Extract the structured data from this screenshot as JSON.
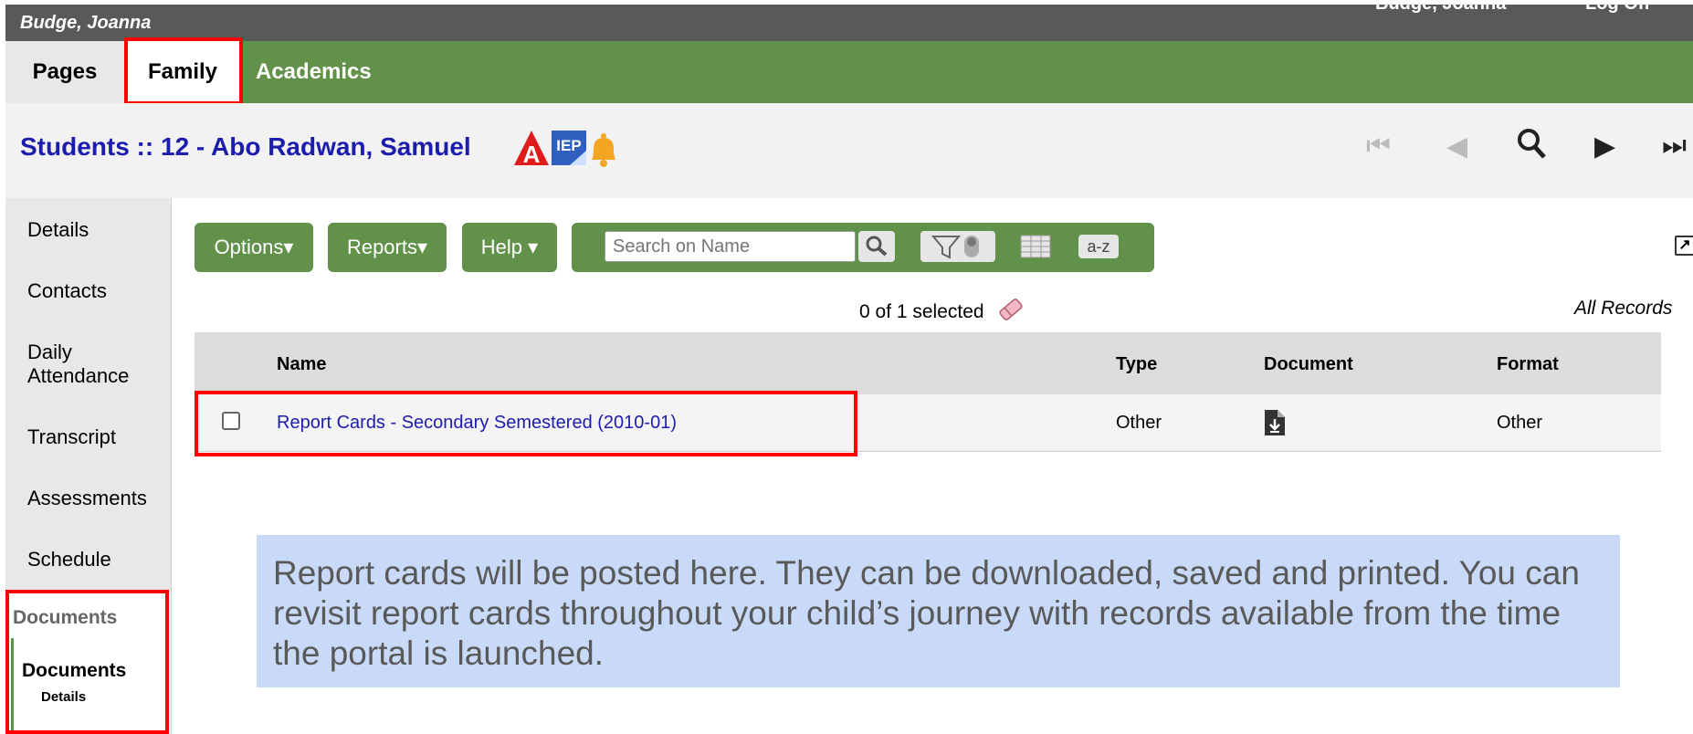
{
  "topbar": {
    "user": "Budge, Joanna",
    "right_user": "Budge, Joanna",
    "logoff": "Log Off"
  },
  "nav": {
    "tabs": [
      {
        "label": "Pages"
      },
      {
        "label": "Family"
      },
      {
        "label": "Academics"
      }
    ]
  },
  "header": {
    "title_prefix": "Students",
    "title_sep": " :: ",
    "title_student": "12 - Abo Radwan, Samuel",
    "iep_label": "IEP"
  },
  "sidebar": {
    "items": [
      {
        "label": "Details"
      },
      {
        "label": "Contacts"
      },
      {
        "label": "Daily Attendance"
      },
      {
        "label": "Transcript"
      },
      {
        "label": "Assessments"
      },
      {
        "label": "Schedule"
      }
    ],
    "group_header": "Documents",
    "active_item": "Documents",
    "active_subitem": "Details"
  },
  "toolbar": {
    "options_label": "Options▾",
    "reports_label": "Reports▾",
    "help_label": "Help ▾",
    "search_placeholder": "Search on Name",
    "az_label": "a-z"
  },
  "selection": {
    "text": "0 of 1 selected",
    "filter_label": "All Records"
  },
  "table": {
    "columns": [
      "Name",
      "Type",
      "Document",
      "Format"
    ],
    "rows": [
      {
        "name": "Report Cards - Secondary Semestered (2010-01)",
        "type": "Other",
        "format": "Other"
      }
    ]
  },
  "note": {
    "text": "Report cards will be posted here.  They can be downloaded, saved and printed.  You can revisit report cards throughout your child’s journey with records available from the time the portal is launched."
  },
  "colors": {
    "nav_green": "#62914a",
    "title_blue": "#1c1cad",
    "highlight_red": "#ff0000",
    "note_blue": "#c9daf8"
  }
}
